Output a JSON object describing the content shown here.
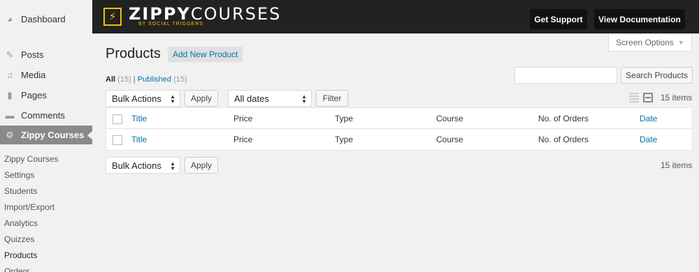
{
  "sidebar": {
    "dashboard": "Dashboard",
    "posts": "Posts",
    "media": "Media",
    "pages": "Pages",
    "comments": "Comments",
    "active": "Zippy Courses",
    "submenu": [
      "Zippy Courses",
      "Settings",
      "Students",
      "Import/Export",
      "Analytics",
      "Quizzes",
      "Products",
      "Orders"
    ]
  },
  "banner": {
    "logo_bold": "ZIPPY",
    "logo_light": "COURSES",
    "logo_sub": "BY SOCIAL TRIGGERS",
    "support": "Get Support",
    "docs": "View Documentation"
  },
  "screen_options": "Screen Options",
  "page": {
    "title": "Products",
    "add_new": "Add New Product"
  },
  "filters": {
    "all_label": "All",
    "all_count": "(15)",
    "sep": "|",
    "published_label": "Published",
    "published_count": "(15)"
  },
  "search": {
    "value": "",
    "button": "Search Products"
  },
  "toolbar": {
    "bulk_actions": "Bulk Actions",
    "apply": "Apply",
    "dates": "All dates",
    "filter": "Filter",
    "items": "15 items"
  },
  "table": {
    "columns": [
      "Title",
      "Price",
      "Type",
      "Course",
      "No. of Orders",
      "Date"
    ]
  }
}
